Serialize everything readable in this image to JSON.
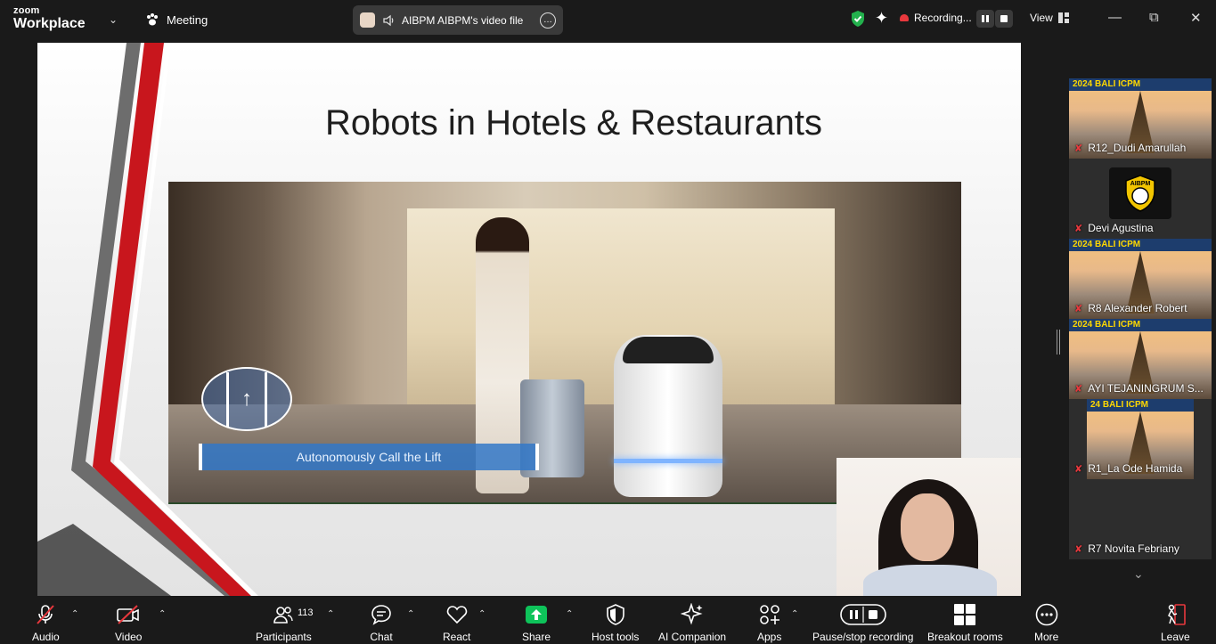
{
  "app": {
    "brand_top": "zoom",
    "brand_bottom": "Workplace",
    "meeting_label": "Meeting",
    "share_pill_label": "AIBPM AIBPM's video file",
    "recording_label": "Recording...",
    "view_label": "View"
  },
  "slide": {
    "title": "Robots in Hotels & Restaurants",
    "caption": "Autonomously Call the Lift"
  },
  "gallery": {
    "participants": [
      {
        "name": "R12_Dudi Amarullah",
        "banner": "2024 BALI ICPM"
      },
      {
        "name": "Devi Agustina",
        "logo": "AIBPM"
      },
      {
        "name": "R8 Alexander Robert",
        "banner": "2024 BALI ICPM"
      },
      {
        "name": "AYI TEJANINGRUM S...",
        "banner": "2024 BALI ICPM"
      },
      {
        "name": "R1_La Ode Hamida",
        "banner": "24 BALI ICPM"
      },
      {
        "name": "R7 Novita Febriany"
      }
    ]
  },
  "toolbar": {
    "audio": "Audio",
    "video": "Video",
    "participants": "Participants",
    "participants_count": "113",
    "chat": "Chat",
    "react": "React",
    "share": "Share",
    "host_tools": "Host tools",
    "ai_companion": "AI Companion",
    "apps": "Apps",
    "pause_stop_recording": "Pause/stop recording",
    "breakout_rooms": "Breakout rooms",
    "more": "More",
    "leave": "Leave"
  },
  "colors": {
    "background": "#1a1a1a",
    "recording_red": "#e8383d",
    "share_green": "#0ec35a",
    "secure_green": "#23b14d",
    "leave_red": "#e8383d"
  },
  "icons": [
    "chevron-down-icon",
    "paw-icon",
    "speaker-icon",
    "more-icon",
    "shield-check-icon",
    "sparkle-icon",
    "cloud-record-icon",
    "pause-icon",
    "stop-icon",
    "grid-icon",
    "minimize-icon",
    "restore-icon",
    "close-icon",
    "mic-off-icon",
    "video-off-icon",
    "participants-icon",
    "chat-icon",
    "heart-icon",
    "share-up-icon",
    "shield-icon",
    "ai-sparkle-icon",
    "apps-icon",
    "breakout-icon",
    "more-dots-icon",
    "leave-icon"
  ]
}
